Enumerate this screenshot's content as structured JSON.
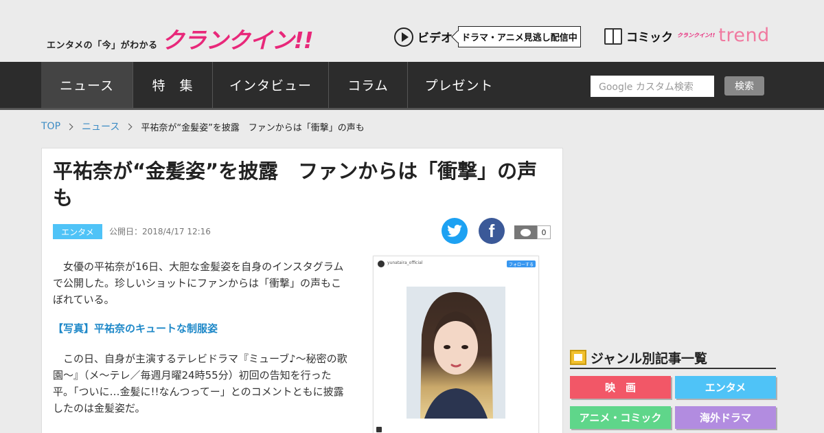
{
  "header": {
    "tagline": "エンタメの「今」がわかる",
    "logo": "クランクイン!!",
    "video_label": "ビデオ",
    "video_bubble": "ドラマ・アニメ見逃し配信中",
    "comic_label": "コミック",
    "trend_small": "クランクイン!!",
    "trend_word": "trend"
  },
  "nav": {
    "items": [
      {
        "label": "ニュース"
      },
      {
        "label": "特　集"
      },
      {
        "label": "インタビュー"
      },
      {
        "label": "コラム"
      },
      {
        "label": "プレゼント"
      }
    ],
    "search_placeholder": "Google カスタム検索",
    "search_button": "検索"
  },
  "breadcrumb": {
    "items": [
      "TOP",
      "ニュース"
    ],
    "current": "平祐奈が“金髪姿”を披露　ファンからは「衝撃」の声も"
  },
  "article": {
    "title": "平祐奈が“金髪姿”を披露　ファンからは「衝撃」の声も",
    "category": "エンタメ",
    "published": "公開日：2018/4/17 12:16",
    "comment_count": "0",
    "paragraph1": "女優の平祐奈が16日、大胆な金髪姿を自身のインスタグラムで公開した。珍しいショットにファンからは「衝撃」の声もこぼれている。",
    "photo_link": "【写真】平祐奈のキュートな制服姿",
    "paragraph2": "この日、自身が主演するテレビドラマ『ミューブ♪～秘密の歌園～』（メ～テレ／毎週月曜24時55分）初回の告知を行った平。「ついに…金髪に!!なんつってー」とのコメントともに披露したのは金髪姿だ。",
    "insta_user": "yunataira_official",
    "insta_follow": "フォローする"
  },
  "sidebar": {
    "genre_title": "ジャンル別記事一覧",
    "genres": [
      {
        "label": "映　画",
        "color": "#f25767"
      },
      {
        "label": "エンタメ",
        "color": "#4fc3f7"
      },
      {
        "label": "アニメ・コミック",
        "color": "#5fd68a"
      },
      {
        "label": "海外ドラマ",
        "color": "#b28ce0"
      }
    ]
  },
  "colors": {
    "brand_pink": "#e8287a",
    "nav_bg": "#2c2c2c",
    "link_blue": "#1e88c8"
  }
}
